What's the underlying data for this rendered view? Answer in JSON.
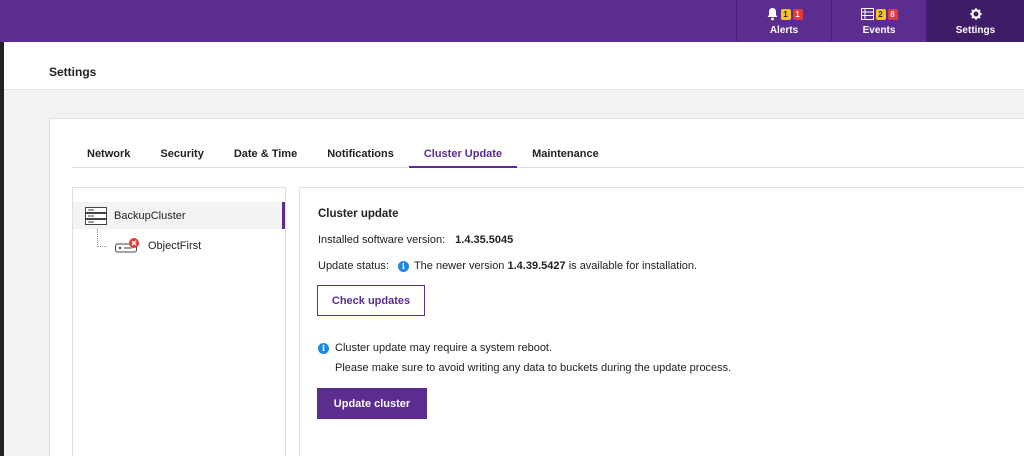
{
  "topnav": {
    "alerts": {
      "label": "Alerts",
      "warn_count": "1",
      "err_count": "1"
    },
    "events": {
      "label": "Events",
      "warn_count": "2",
      "err_count": "8"
    },
    "settings": {
      "label": "Settings"
    }
  },
  "page": {
    "title": "Settings"
  },
  "tabs": [
    "Network",
    "Security",
    "Date & Time",
    "Notifications",
    "Cluster Update",
    "Maintenance"
  ],
  "active_tab": "Cluster Update",
  "tree": {
    "root": "BackupCluster",
    "child": "ObjectFirst"
  },
  "cluster_update": {
    "title": "Cluster update",
    "version_label": "Installed software version:",
    "version_value": "1.4.35.5045",
    "status_label": "Update status:",
    "status_prefix": "The newer version",
    "status_version": "1.4.39.5427",
    "status_suffix": "is available for installation.",
    "check_button": "Check updates",
    "note_line1": "Cluster update may require a system reboot.",
    "note_line2": "Please make sure to avoid writing any data to buckets during the update process.",
    "update_button": "Update cluster"
  },
  "colors": {
    "brand": "#5b2d8e",
    "info": "#1e88e5",
    "badge_warn": "#f5c518",
    "badge_err": "#e53935"
  },
  "icons": [
    "bell-icon",
    "events-list-icon",
    "gear-icon",
    "server-stack-icon",
    "storage-node-error-icon",
    "info-icon"
  ]
}
